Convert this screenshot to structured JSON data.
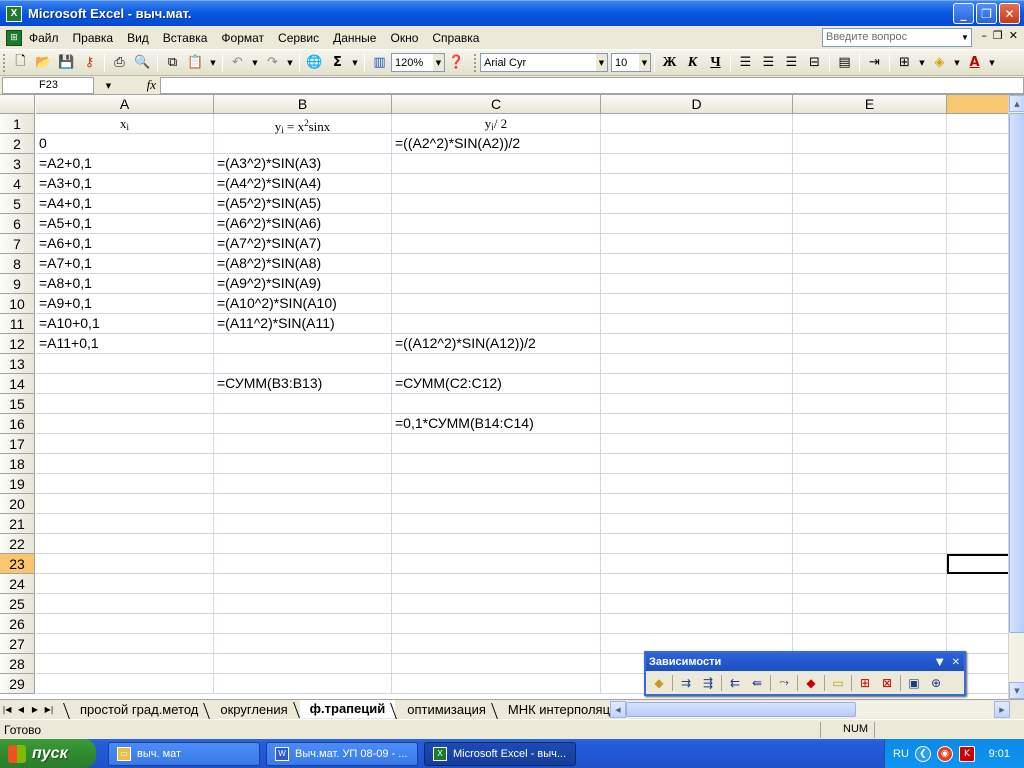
{
  "window": {
    "title": "Microsoft Excel - выч.мат.",
    "app_icon": "X"
  },
  "menu": {
    "items": [
      "Файл",
      "Правка",
      "Вид",
      "Вставка",
      "Формат",
      "Сервис",
      "Данные",
      "Окно",
      "Справка"
    ],
    "ask_placeholder": "Введите вопрос"
  },
  "toolbar": {
    "zoom": "120%",
    "font_name": "Arial Cyr",
    "font_size": "10",
    "bold": "Ж",
    "italic": "К",
    "underline": "Ч",
    "autosum": "Σ"
  },
  "formula_bar": {
    "name_box": "F23",
    "fx": "fx",
    "formula": ""
  },
  "columns": [
    "A",
    "B",
    "C",
    "D",
    "E"
  ],
  "rows": [
    "1",
    "2",
    "3",
    "4",
    "5",
    "6",
    "7",
    "8",
    "9",
    "10",
    "11",
    "12",
    "13",
    "14",
    "15",
    "16",
    "17",
    "18",
    "19",
    "20",
    "21",
    "22",
    "23",
    "24",
    "25",
    "26",
    "27",
    "28",
    "29"
  ],
  "headers": {
    "a1_main": "x",
    "a1_sub": "i",
    "b1_y": "y",
    "b1_sub": "i",
    "b1_eq": " = x",
    "b1_sup": "2",
    "b1_rest": "sinx",
    "c1_y": "y",
    "c1_sub": "i",
    "c1_rest": "/ 2"
  },
  "cells": {
    "A2": "0",
    "A3": "=A2+0,1",
    "A4": "=A3+0,1",
    "A5": "=A4+0,1",
    "A6": "=A5+0,1",
    "A7": "=A6+0,1",
    "A8": "=A7+0,1",
    "A9": "=A8+0,1",
    "A10": "=A9+0,1",
    "A11": "=A10+0,1",
    "A12": "=A11+0,1",
    "B3": "=(A3^2)*SIN(A3)",
    "B4": "=(A4^2)*SIN(A4)",
    "B5": "=(A5^2)*SIN(A5)",
    "B6": "=(A6^2)*SIN(A6)",
    "B7": "=(A7^2)*SIN(A7)",
    "B8": "=(A8^2)*SIN(A8)",
    "B9": "=(A9^2)*SIN(A9)",
    "B10": "=(A10^2)*SIN(A10)",
    "B11": "=(A11^2)*SIN(A11)",
    "B14": "=СУММ(B3:B13)",
    "C2": "=((A2^2)*SIN(A2))/2",
    "C12": "=((A12^2)*SIN(A12))/2",
    "C14": "=СУММ(C2:C12)",
    "C16": "=0,1*СУММ(B14:C14)"
  },
  "selected_cell": "F23",
  "sheets": {
    "tabs": [
      "простой град.метод",
      "округления",
      "ф.трапеций",
      "оптимизация",
      "МНК интерполяция"
    ],
    "active": "ф.трапеций"
  },
  "status": {
    "ready": "Готово",
    "num": "NUM"
  },
  "dependencies_toolbar": {
    "title": "Зависимости"
  },
  "taskbar": {
    "start": "пуск",
    "items": [
      "выч. мат",
      "Выч.мат. УП 08-09 - ...",
      "Microsoft Excel - выч..."
    ],
    "lang": "RU",
    "clock": "9:01"
  }
}
